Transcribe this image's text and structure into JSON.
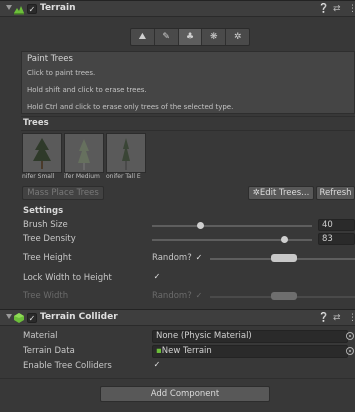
{
  "terrain": {
    "title": "Terrain",
    "enabled_mark": "✓",
    "tools": [
      {
        "name": "raise-lower-icon",
        "glyph": "⛰"
      },
      {
        "name": "paint-brush-icon",
        "glyph": "✎"
      },
      {
        "name": "paint-trees-icon",
        "glyph": "♣"
      },
      {
        "name": "paint-details-icon",
        "glyph": "❋"
      },
      {
        "name": "settings-gear-icon",
        "glyph": "✲"
      }
    ],
    "help": {
      "title": "Paint Trees",
      "lines": [
        "Click to paint trees.",
        "Hold shift and click to erase trees.",
        "Hold Ctrl and click to erase only trees of the selected type."
      ]
    },
    "trees_heading": "Trees",
    "tree_items": [
      {
        "label": "nifer Small"
      },
      {
        "label": "ifer Medium"
      },
      {
        "label": "onifer Tall E"
      }
    ],
    "mass_place_label": "Mass Place Trees",
    "edit_trees_label": "Edit Trees...",
    "refresh_label": "Refresh",
    "settings_heading": "Settings",
    "brush_size": {
      "label": "Brush Size",
      "value": "40",
      "level": 0.3
    },
    "tree_density": {
      "label": "Tree Density",
      "value": "83",
      "level": 0.83
    },
    "tree_height": {
      "label": "Tree Height",
      "random_label": "Random?",
      "random_checked": "✓"
    },
    "lock_width": {
      "label": "Lock Width to Height",
      "checked": "✓"
    },
    "tree_width": {
      "label": "Tree Width",
      "random_label": "Random?",
      "random_checked": "✓"
    }
  },
  "collider": {
    "title": "Terrain Collider",
    "enabled_mark": "✓",
    "material": {
      "label": "Material",
      "value": "None (Physic Material)"
    },
    "terrain_data": {
      "label": "Terrain Data",
      "value": "New Terrain"
    },
    "enable_tree_colliders": {
      "label": "Enable Tree Colliders",
      "checked": "✓"
    }
  },
  "add_component_label": "Add Component",
  "header_icons": {
    "help": "❔",
    "presets": "⇄",
    "menu": "⋮"
  },
  "colors": {
    "accent_green": "#6cbf3a",
    "background": "#383838"
  }
}
